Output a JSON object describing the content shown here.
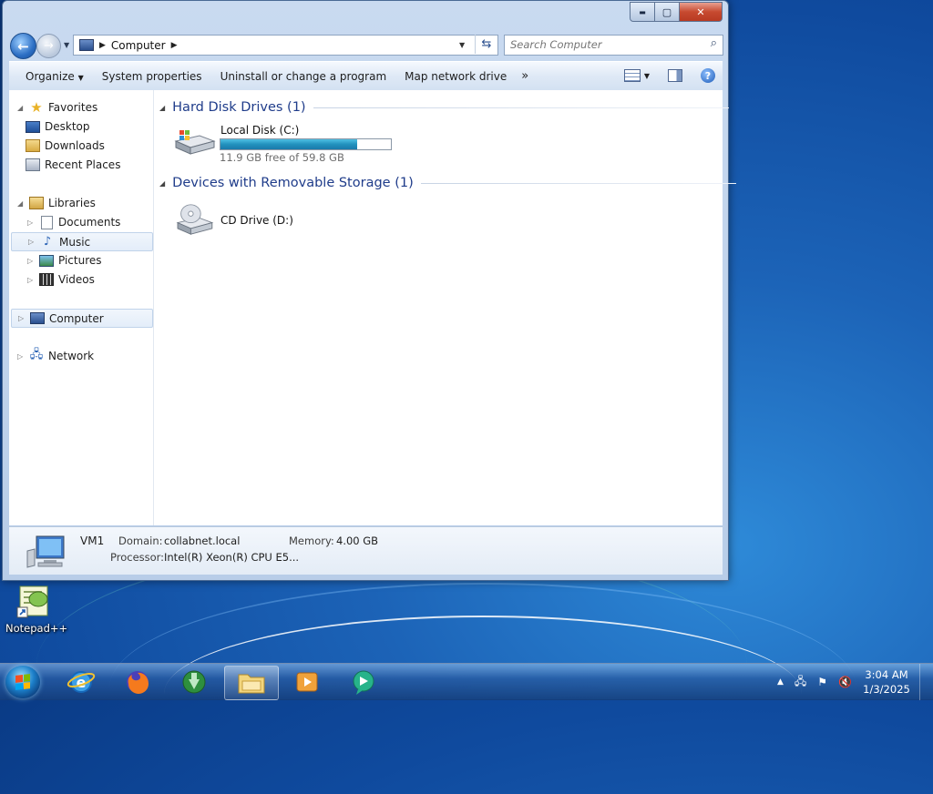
{
  "window": {
    "controls": {
      "minimize": "▬",
      "maximize": "▢",
      "close": "✕"
    }
  },
  "address_bar": {
    "crumbs": [
      "Computer"
    ],
    "search_placeholder": "Search Computer"
  },
  "toolbar": {
    "organize": "Organize",
    "system_properties": "System properties",
    "uninstall": "Uninstall or change a program",
    "map_network": "Map network drive",
    "more": "»"
  },
  "nav": {
    "favorites": {
      "label": "Favorites",
      "items": [
        "Desktop",
        "Downloads",
        "Recent Places"
      ]
    },
    "libraries": {
      "label": "Libraries",
      "items": [
        "Documents",
        "Music",
        "Pictures",
        "Videos"
      ]
    },
    "computer": "Computer",
    "network": "Network"
  },
  "content": {
    "hard_disk_header": "Hard Disk Drives (1)",
    "local_disk": {
      "name": "Local Disk (C:)",
      "free_text": "11.9 GB free of 59.8 GB",
      "used_fraction": 0.8
    },
    "removable_header": "Devices with Removable Storage (1)",
    "cd_drive": {
      "name": "CD Drive (D:)"
    }
  },
  "details": {
    "name": "VM1",
    "domain_label": "Domain:",
    "domain_value": "collabnet.local",
    "memory_label": "Memory:",
    "memory_value": "4.00 GB",
    "processor_label": "Processor:",
    "processor_value": "Intel(R) Xeon(R) CPU E5..."
  },
  "desktop": {
    "icon_label": "Notepad++"
  },
  "taskbar": {
    "time": "3:04 AM",
    "date": "1/3/2025",
    "apps": [
      "internet-explorer",
      "firefox",
      "download-manager",
      "windows-explorer",
      "media-player",
      "chat-app"
    ]
  }
}
